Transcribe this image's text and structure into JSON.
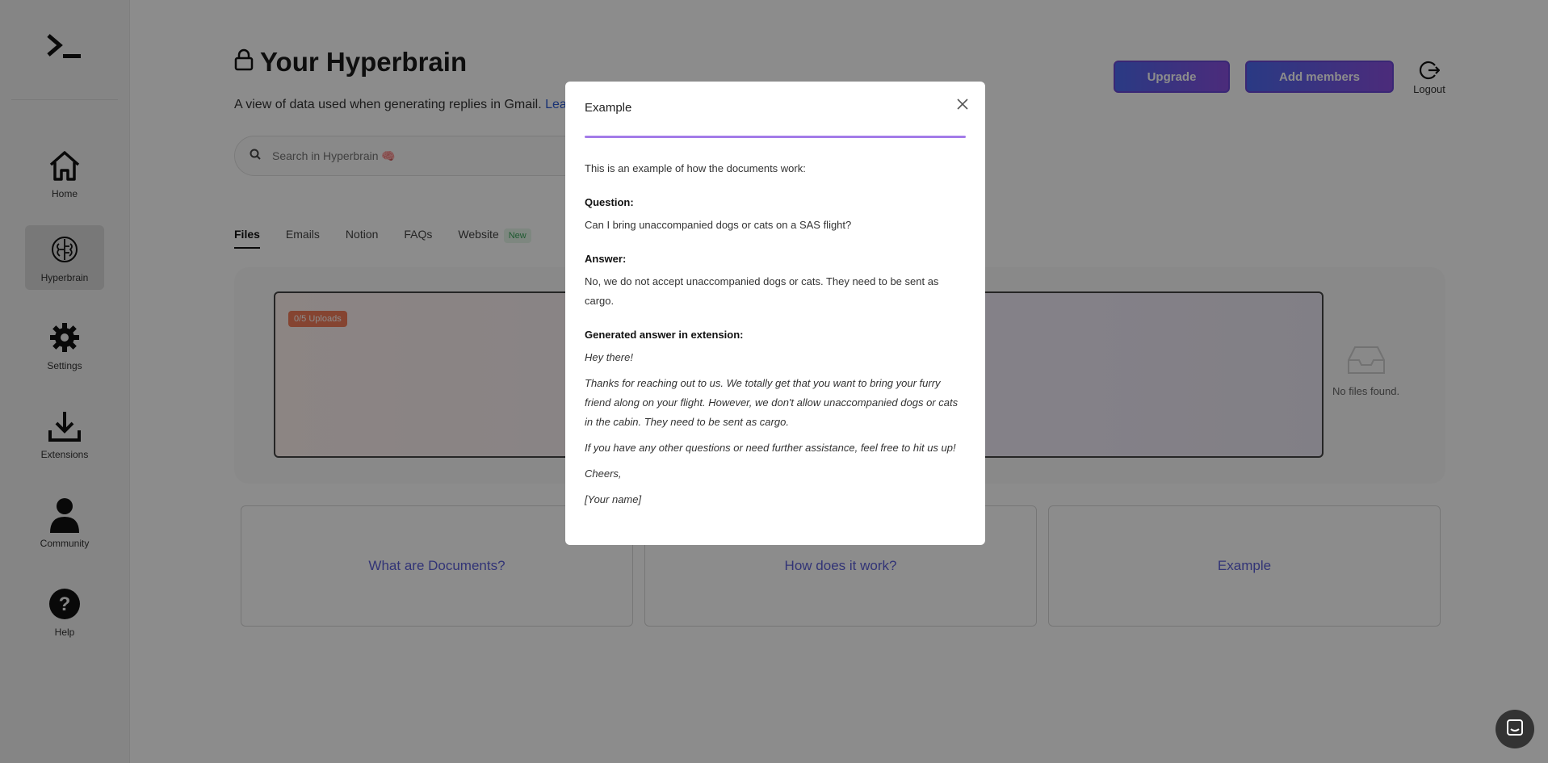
{
  "sidebar": {
    "items": [
      {
        "label": "Home",
        "icon": "home-icon"
      },
      {
        "label": "Hyperbrain",
        "icon": "brain-icon",
        "active": true
      },
      {
        "label": "Settings",
        "icon": "gear-icon"
      },
      {
        "label": "Extensions",
        "icon": "download-icon"
      },
      {
        "label": "Community",
        "icon": "user-icon"
      },
      {
        "label": "Help",
        "icon": "help-icon"
      }
    ]
  },
  "header": {
    "title": "Your Hyperbrain",
    "subtitle": "A view of data used when generating replies in Gmail.",
    "subtitle_link": "Lear",
    "upgrade_label": "Upgrade",
    "add_members_label": "Add members",
    "logout_label": "Logout"
  },
  "search": {
    "placeholder": "Search in Hyperbrain 🧠"
  },
  "tabs": [
    {
      "label": "Files",
      "active": true
    },
    {
      "label": "Emails"
    },
    {
      "label": "Notion"
    },
    {
      "label": "FAQs"
    },
    {
      "label": "Website",
      "badge": "New"
    }
  ],
  "files": {
    "uploads_badge": "0/5 Uploads",
    "empty_text": "No files found."
  },
  "cards": [
    {
      "label": "What are Documents?"
    },
    {
      "label": "How does it work?"
    },
    {
      "label": "Example"
    }
  ],
  "modal": {
    "title": "Example",
    "intro": "This is an example of how the documents work:",
    "question_heading": "Question:",
    "question_text": "Can I bring unaccompanied dogs or cats on a SAS flight?",
    "answer_heading": "Answer:",
    "answer_text": "No, we do not accept unaccompanied dogs or cats. They need to be sent as cargo.",
    "generated_heading": "Generated answer in extension:",
    "generated": [
      "Hey there!",
      "Thanks for reaching out to us. We totally get that you want to bring your furry friend along on your flight. However, we don't allow unaccompanied dogs or cats in the cabin. They need to be sent as cargo.",
      "If you have any other questions or need further assistance, feel free to hit us up!",
      "Cheers,",
      "[Your name]"
    ]
  },
  "colors": {
    "accent_purple": "#a37be8",
    "button_gradient_start": "#4d6af0",
    "button_gradient_end": "#8a4fe0",
    "link_blue": "#5b5fd8",
    "uploads_badge": "#f27c5a"
  }
}
